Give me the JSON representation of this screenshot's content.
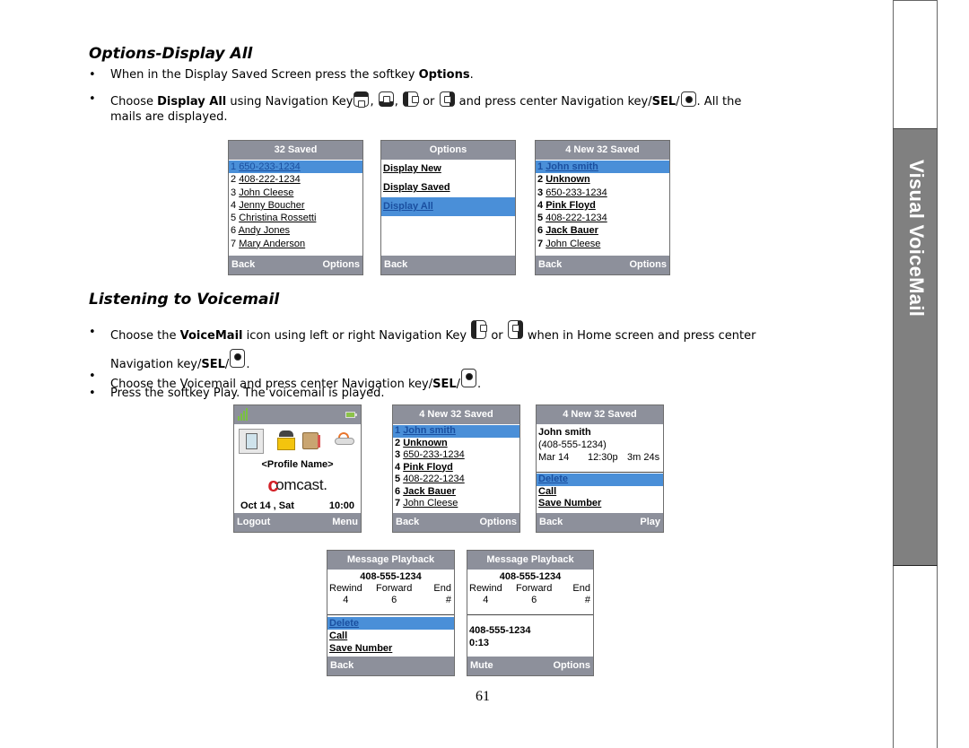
{
  "section1": {
    "title": "Options-Display All",
    "bullets": [
      {
        "pre": "When in the Display Saved Screen press the softkey ",
        "bold": "Options",
        "post": "."
      },
      {
        "pre": "Choose ",
        "bold": "Display All",
        "mid": " using Navigation Key",
        "sep1": ", ",
        "sep2": ", ",
        "or": " or ",
        "mid2": " and press center Navigation key/",
        "sel": "SEL",
        "slash": "/",
        "post": ". All the",
        "line2": "mails are displayed."
      }
    ],
    "nav_icons": [
      "nav-up-icon",
      "nav-down-icon",
      "nav-left-icon",
      "nav-right-icon",
      "nav-center-icon"
    ]
  },
  "screens_top": [
    {
      "header": "32 Saved",
      "items": [
        {
          "num": "1",
          "text": "650-233-1234",
          "selected": true
        },
        {
          "num": "2",
          "text": "408-222-1234"
        },
        {
          "num": "3",
          "text": "John Cleese"
        },
        {
          "num": "4",
          "text": "Jenny Boucher"
        },
        {
          "num": "5",
          "text": "Christina Rossetti"
        },
        {
          "num": "6",
          "text": "Andy Jones"
        },
        {
          "num": "7",
          "text": "Mary Anderson"
        }
      ],
      "softkey_left": "Back",
      "softkey_right": "Options"
    },
    {
      "header": "Options",
      "options": [
        {
          "text": "Display New"
        },
        {
          "text": "Display Saved"
        },
        {
          "text": "Display All",
          "selected": true
        }
      ],
      "softkey_left": "Back",
      "softkey_right": ""
    },
    {
      "header": "4 New 32 Saved",
      "items": [
        {
          "num": "1",
          "text": "John smith",
          "selected": true,
          "bold": true
        },
        {
          "num": "2",
          "text": "Unknown",
          "bold": true
        },
        {
          "num": "3",
          "text": "650-233-1234"
        },
        {
          "num": "4",
          "text": "Pink Floyd",
          "bold": true
        },
        {
          "num": "5",
          "text": "408-222-1234"
        },
        {
          "num": "6",
          "text": "Jack Bauer",
          "bold": true
        },
        {
          "num": "7",
          "text": "John Cleese"
        }
      ],
      "softkey_left": "Back",
      "softkey_right": "Options"
    }
  ],
  "section2": {
    "title": "Listening to Voicemail",
    "bullet1": {
      "pre": "Choose the ",
      "bold": "VoiceMail",
      "mid": " icon using left or right Navigation Key ",
      "or": " or ",
      "post": "  when in Home screen and press center",
      "line2_pre": "Navigation key/",
      "sel": "SEL",
      "slash": "/",
      "line2_post": "."
    },
    "bullet2": {
      "pre": "Choose the Voicemail and press center Navigation key/",
      "sel": "SEL",
      "slash": "/",
      "post": "."
    },
    "bullet3": {
      "text": "Press the softkey Play. The voicemail is played."
    }
  },
  "home_screen": {
    "profile": "<Profile Name>",
    "logo": "comcast.",
    "logo_c": "c",
    "logo_rest": "omcast.",
    "date": "Oct 14 , Sat",
    "time": "10:00",
    "softkey_left": "Logout",
    "softkey_right": "Menu",
    "icons": [
      "signal-icon",
      "battery-icon",
      "voicemail-app-icon",
      "phonebook-app-icon",
      "notebook-app-icon",
      "weather-app-icon"
    ]
  },
  "list_screen": {
    "header": "4 New 32 Saved",
    "items": [
      {
        "num": "1",
        "text": "John smith",
        "selected": true,
        "bold": true
      },
      {
        "num": "2",
        "text": "Unknown",
        "bold": true
      },
      {
        "num": "3",
        "text": "650-233-1234"
      },
      {
        "num": "4",
        "text": "Pink Floyd",
        "bold": true
      },
      {
        "num": "5",
        "text": "408-222-1234"
      },
      {
        "num": "6",
        "text": "Jack Bauer",
        "bold": true
      },
      {
        "num": "7",
        "text": "John Cleese"
      }
    ],
    "softkey_left": "Back",
    "softkey_right": "Options"
  },
  "detail_screen": {
    "header": "4 New 32 Saved",
    "name": "John smith",
    "number": "(408-555-1234)",
    "date": "Mar 14",
    "time": "12:30p",
    "duration": "3m 24s",
    "options": [
      {
        "text": "Delete",
        "selected": true
      },
      {
        "text": "Call"
      },
      {
        "text": "Save Number"
      }
    ],
    "softkey_left": "Back",
    "softkey_right": "Play"
  },
  "playback_screens": [
    {
      "header": "Message Playback",
      "number": "408-555-1234",
      "controls": [
        {
          "label": "Rewind",
          "key": "4"
        },
        {
          "label": "Forward",
          "key": "6"
        },
        {
          "label": "End",
          "key": "#"
        }
      ],
      "options": [
        {
          "text": "Delete",
          "selected": true
        },
        {
          "text": "Call"
        },
        {
          "text": "Save Number"
        }
      ],
      "softkey_left": "Back",
      "softkey_right": ""
    },
    {
      "header": "Message Playback",
      "number": "408-555-1234",
      "controls": [
        {
          "label": "Rewind",
          "key": "4"
        },
        {
          "label": "Forward",
          "key": "6"
        },
        {
          "label": "End",
          "key": "#"
        }
      ],
      "playing_number": "408-555-1234",
      "elapsed": "0:13",
      "softkey_left": "Mute",
      "softkey_right": "Options"
    }
  ],
  "side_tab": {
    "label": "Visual VoiceMail"
  },
  "page_number": "61",
  "colors": {
    "header_gray": "#8d909b",
    "highlight_blue": "#4a8fd8",
    "side_tab_gray": "#808080"
  }
}
